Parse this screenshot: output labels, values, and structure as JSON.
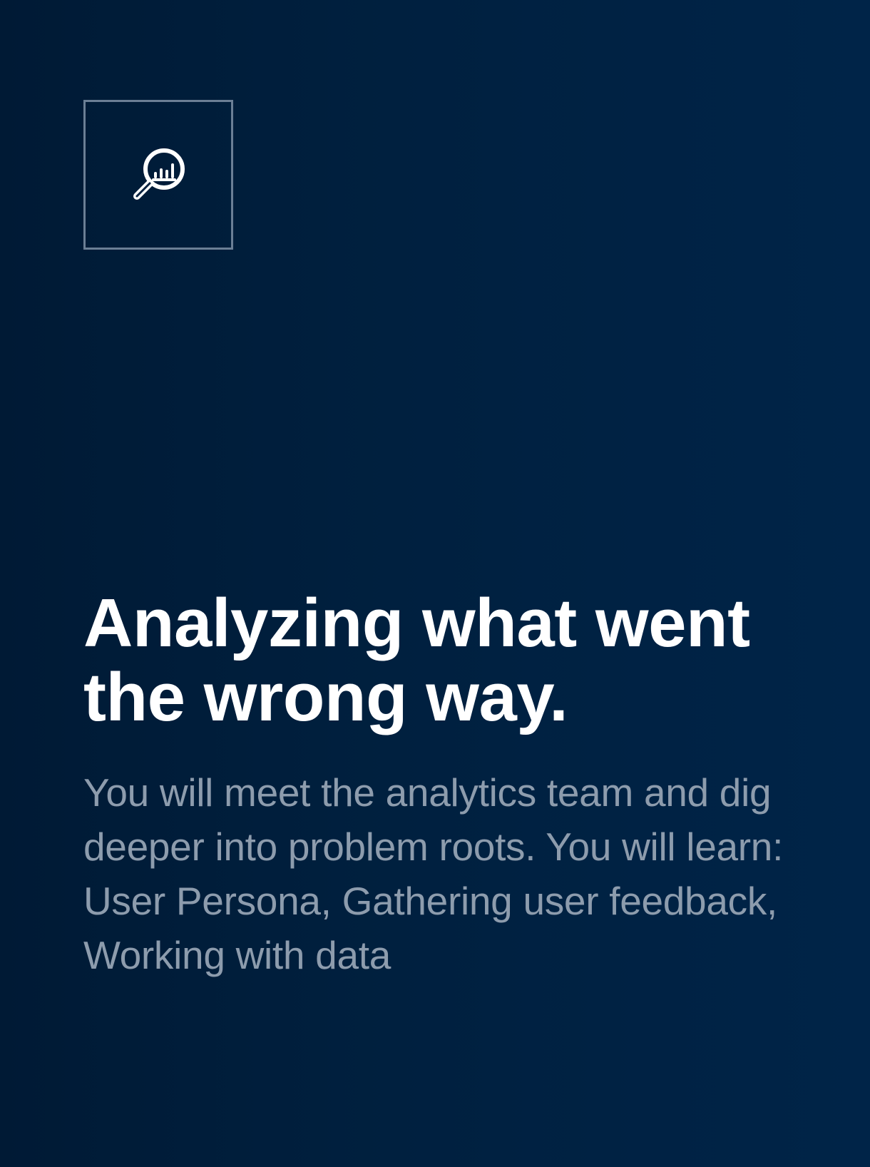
{
  "card": {
    "icon": "magnifier-chart-icon",
    "title": "Analyzing what went the wrong way.",
    "description": "You will meet the analytics team and dig deeper into problem roots. You will learn: User Persona, Gathering user feedback, Working with data"
  },
  "colors": {
    "background_left": "#001a35",
    "background_right": "#002448",
    "icon_border": "#6b7f95",
    "title": "#ffffff",
    "description": "#8d9cad"
  }
}
